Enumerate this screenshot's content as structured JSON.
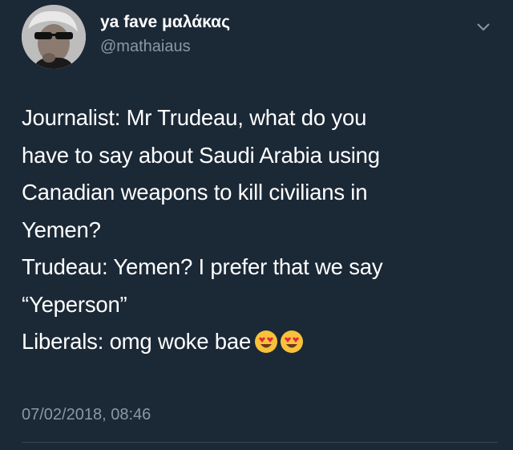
{
  "user": {
    "display_name": "ya fave μαλάκας",
    "handle": "@mathaiaus",
    "avatar_icon": "avatar-man-sunglasses"
  },
  "tweet": {
    "lines": [
      "Journalist: Mr Trudeau, what do you",
      "have to say about Saudi Arabia using",
      "Canadian weapons to kill civilians in",
      "Yemen?",
      "Trudeau: Yemen? I prefer that we say",
      "“Yeperson”",
      "Liberals: omg woke bae"
    ],
    "emoji": [
      "heart-eyes-emoji",
      "heart-eyes-emoji"
    ],
    "timestamp": "07/02/2018, 08:46"
  },
  "menu_icon": "chevron-down-icon",
  "colors": {
    "background": "#1b2836",
    "text": "#ffffff",
    "muted": "#8899a6",
    "divider": "#38444d"
  }
}
